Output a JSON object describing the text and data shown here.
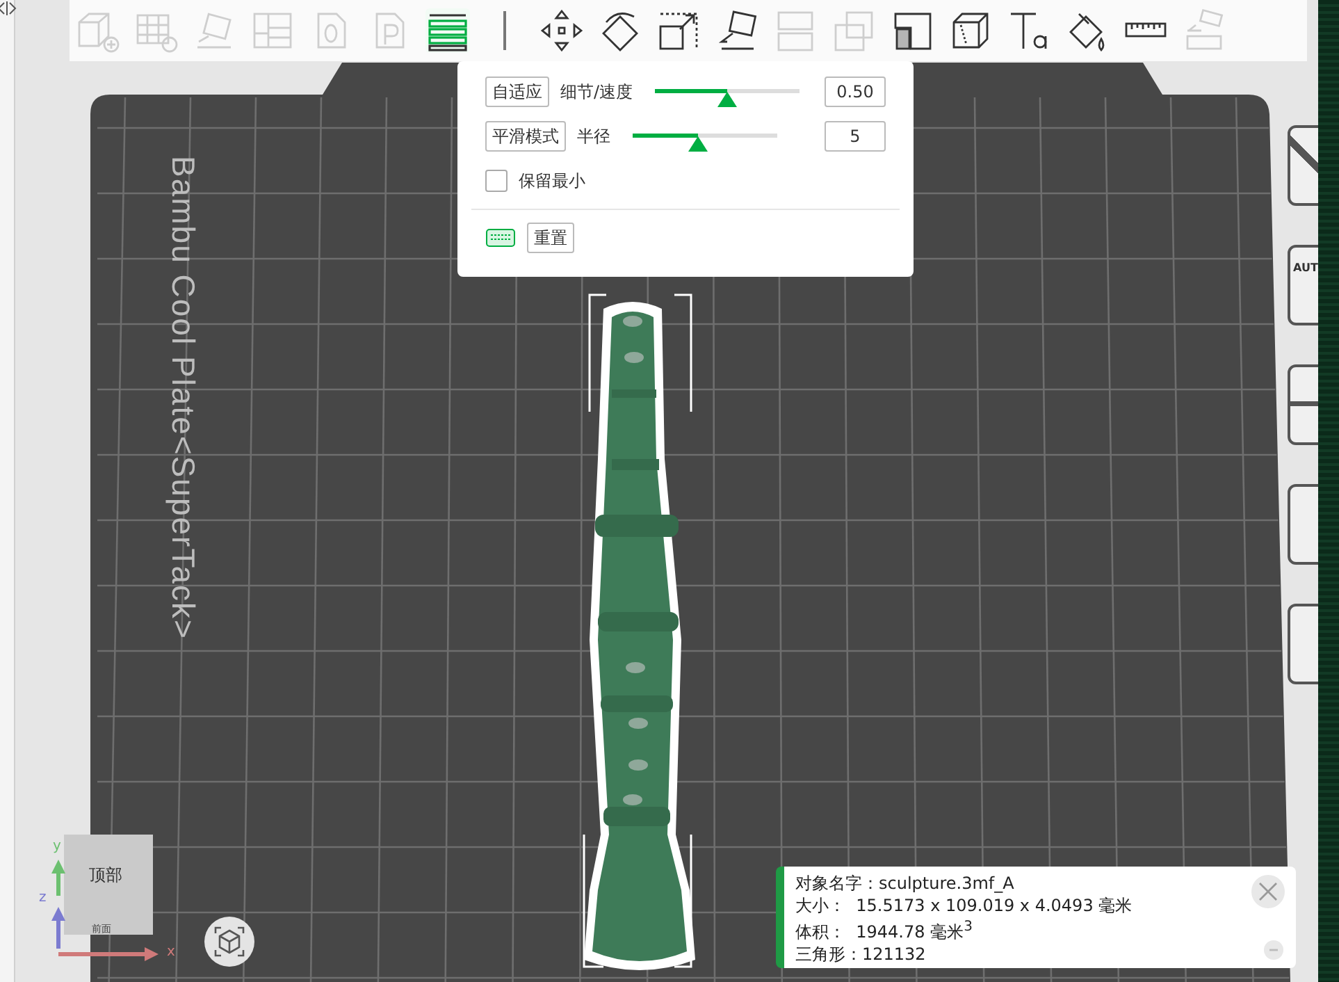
{
  "toolbar": [
    {
      "kind": "add-object",
      "disabled": true,
      "selected": false
    },
    {
      "kind": "add-plate",
      "disabled": true,
      "selected": false
    },
    {
      "kind": "auto-orient",
      "disabled": true,
      "selected": false
    },
    {
      "kind": "arrange",
      "disabled": true,
      "selected": false
    },
    {
      "kind": "plate-zero",
      "disabled": true,
      "selected": false
    },
    {
      "kind": "plate-p",
      "disabled": true,
      "selected": false
    },
    {
      "kind": "layers",
      "disabled": false,
      "selected": true
    },
    {
      "kind": "move",
      "disabled": false,
      "selected": false
    },
    {
      "kind": "rotate",
      "disabled": false,
      "selected": false
    },
    {
      "kind": "scale",
      "disabled": false,
      "selected": false
    },
    {
      "kind": "lay-on-face",
      "disabled": false,
      "selected": false
    },
    {
      "kind": "split",
      "disabled": true,
      "selected": false
    },
    {
      "kind": "cut",
      "disabled": true,
      "selected": false
    },
    {
      "kind": "support-paint",
      "disabled": false,
      "selected": false
    },
    {
      "kind": "seam",
      "disabled": false,
      "selected": false
    },
    {
      "kind": "text",
      "disabled": false,
      "selected": false
    },
    {
      "kind": "color-paint",
      "disabled": false,
      "selected": false
    },
    {
      "kind": "measure",
      "disabled": false,
      "selected": false
    },
    {
      "kind": "assembly",
      "disabled": true,
      "selected": false
    }
  ],
  "plate_label": "Bambu Cool Plate<SuperTack>",
  "smoothing_panel": {
    "rows": [
      {
        "kind": "slider",
        "button": "自适应",
        "label": "细节/速度",
        "level": 0.5,
        "value": "0.50"
      },
      {
        "kind": "slider",
        "button": "平滑模式",
        "label": "半径",
        "level": 0.45,
        "value": "5"
      },
      {
        "kind": "checkbox",
        "label": "保留最小",
        "checked": false
      }
    ],
    "reset_button": "重置"
  },
  "side_tools": [
    {
      "kind": "cross"
    },
    {
      "kind": "auto",
      "label": "AUT"
    },
    {
      "kind": "split"
    },
    {
      "kind": "plain"
    },
    {
      "kind": "plain"
    }
  ],
  "view_cube": {
    "top": "顶部",
    "front": "前面"
  },
  "axes": {
    "y": "y",
    "z": "z",
    "x": "x"
  },
  "object_info": {
    "lines": [
      "对象名字：sculpture.3mf_A",
      "大小：  15.5173 x 109.019 x 4.0493 毫米",
      "体积：  1944.78 毫米$^{3}$",
      "三角形：121132"
    ]
  }
}
